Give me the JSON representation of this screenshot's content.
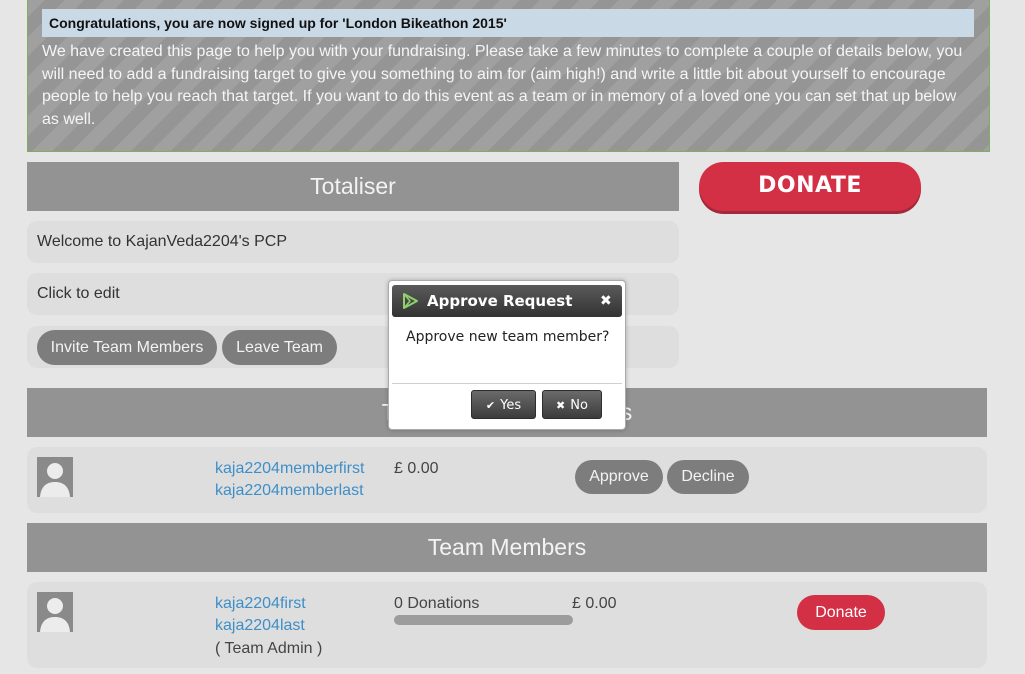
{
  "banner": {
    "title": "Congratulations, you are now signed up for 'London Bikeathon 2015'",
    "text": "We have created this page to help you with your fundraising. Please take a few minutes to complete a couple of details below, you will need to add a fundraising target to give you something to aim for (aim high!) and write a little bit about yourself to encourage people to help you reach that target. If you want to do this event as a team or in memory of a loved one you can set that up below as well."
  },
  "totaliser": {
    "header": "Totaliser",
    "donate_label": "DONATE"
  },
  "profile": {
    "welcome": "Welcome to KajanVeda2204's PCP",
    "edit_prompt": "Click to edit",
    "invite_label": "Invite Team Members",
    "leave_label": "Leave Team"
  },
  "requests": {
    "header": "Team Member Requests",
    "row": {
      "first": "kaja2204memberfirst",
      "last": "kaja2204memberlast",
      "amount": "£ 0.00",
      "approve_label": "Approve",
      "decline_label": "Decline"
    }
  },
  "members": {
    "header": "Team Members",
    "row": {
      "first": "kaja2204first",
      "last": "kaja2204last",
      "role": "( Team Admin )",
      "donations": "0 Donations",
      "progress": 0,
      "amount": "£ 0.00",
      "donate_label": "Donate"
    }
  },
  "dialog": {
    "title": "Approve Request",
    "message": "Approve new team member?",
    "yes_label": "Yes",
    "no_label": "No"
  },
  "colors": {
    "accent_red": "#d32f45",
    "header_grey": "#939393",
    "link_blue": "#3e8fc8"
  }
}
